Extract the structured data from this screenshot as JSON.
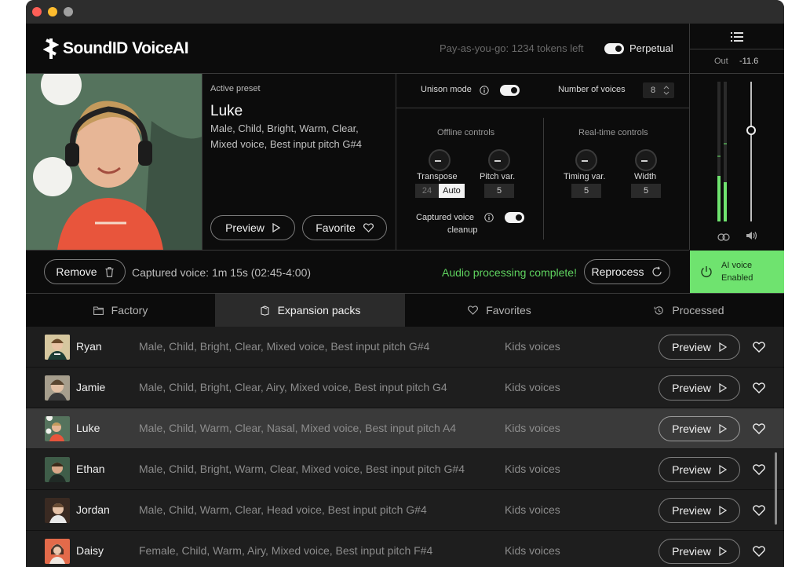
{
  "app": {
    "logo_text": "SoundID VoiceAI"
  },
  "header": {
    "tokens_text": "Pay-as-you-go: 1234 tokens left",
    "perpetual_label": "Perpetual"
  },
  "preset": {
    "heading": "Active preset",
    "name": "Luke",
    "tags_line1": "Male, Child, Bright, Warm, Clear,",
    "tags_line2": "Mixed voice, Best input pitch  G#4",
    "preview_label": "Preview",
    "favorite_label": "Favorite"
  },
  "controls": {
    "unison_label": "Unison mode",
    "voices_label": "Number of voices",
    "voices_value": "8",
    "offline_title": "Offline controls",
    "realtime_title": "Real-time controls",
    "transpose_label": "Transpose",
    "transpose_value": "24",
    "transpose_auto": "Auto",
    "pitchvar_label": "Pitch var.",
    "pitchvar_value": "5",
    "timingvar_label": "Timing var.",
    "timingvar_value": "5",
    "width_label": "Width",
    "width_value": "5",
    "cleanup_line1": "Captured voice",
    "cleanup_line2": "cleanup"
  },
  "meter": {
    "out_label": "Out",
    "out_value": "-11.6"
  },
  "status": {
    "remove_label": "Remove",
    "captured_text": "Captured voice: 1m 15s (02:45-4:00)",
    "complete_text": "Audio processing complete!",
    "reprocess_label": "Reprocess",
    "ai_line1": "AI voice",
    "ai_line2": "Enabled"
  },
  "tabs": [
    {
      "label": "Factory",
      "icon": "folder-icon"
    },
    {
      "label": "Expansion packs",
      "icon": "package-icon"
    },
    {
      "label": "Favorites",
      "icon": "heart-icon"
    },
    {
      "label": "Processed",
      "icon": "history-icon"
    }
  ],
  "voices": [
    {
      "name": "Ryan",
      "desc": "Male, Child, Bright, Clear, Mixed voice, Best input pitch G#4",
      "pack": "Kids voices",
      "preview": "Preview"
    },
    {
      "name": "Jamie",
      "desc": "Male, Child, Bright, Clear, Airy, Mixed voice, Best input pitch  G4",
      "pack": "Kids voices",
      "preview": "Preview"
    },
    {
      "name": "Luke",
      "desc": "Male, Child, Warm, Clear, Nasal, Mixed voice, Best input pitch  A4",
      "pack": "Kids voices",
      "preview": "Preview"
    },
    {
      "name": "Ethan",
      "desc": "Male, Child, Bright, Warm, Clear, Mixed voice, Best input pitch  G#4",
      "pack": "Kids voices",
      "preview": "Preview"
    },
    {
      "name": "Jordan",
      "desc": "Male, Child, Warm, Clear, Head voice, Best input pitch  G#4",
      "pack": "Kids voices",
      "preview": "Preview"
    },
    {
      "name": "Daisy",
      "desc": "Female, Child, Warm, Airy, Mixed voice, Best input pitch  F#4",
      "pack": "Kids voices",
      "preview": "Preview"
    }
  ],
  "colors": {
    "accent_green": "#6fe36f",
    "complete_green": "#5fd35f",
    "selected_row": "#3a3a3a"
  }
}
